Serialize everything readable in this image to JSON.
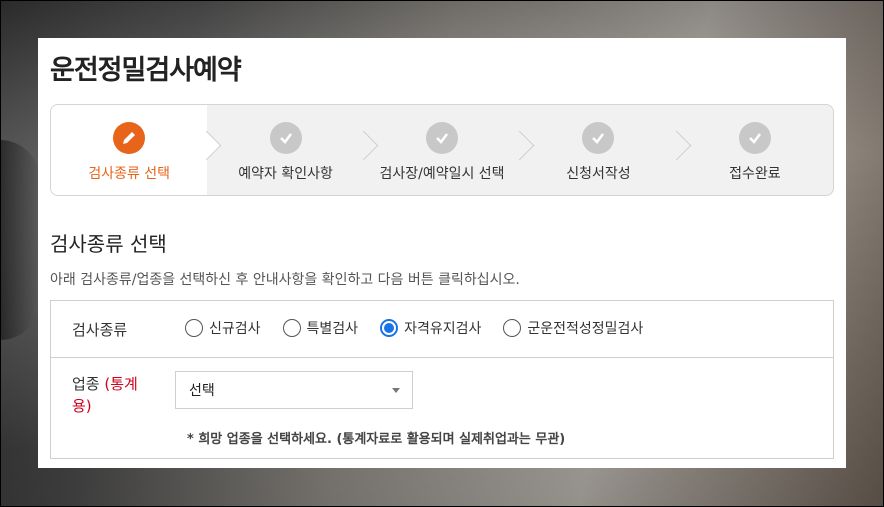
{
  "page": {
    "title": "운전정밀검사예약"
  },
  "steps": [
    {
      "label": "검사종류 선택",
      "icon": "pencil-icon",
      "active": true
    },
    {
      "label": "예약자 확인사항",
      "icon": "check-icon",
      "active": false
    },
    {
      "label": "검사장/예약일시 선택",
      "icon": "check-icon",
      "active": false
    },
    {
      "label": "신청서작성",
      "icon": "check-icon",
      "active": false
    },
    {
      "label": "접수완료",
      "icon": "check-icon",
      "active": false
    }
  ],
  "section": {
    "title": "검사종류 선택",
    "description": "아래 검사종류/업종을 선택하신 후 안내사항을 확인하고 다음 버튼 클릭하십시오."
  },
  "form": {
    "inspection_type_label": "검사종류",
    "inspection_types": [
      "신규검사",
      "특별검사",
      "자격유지검사",
      "군운전적성정밀검사"
    ],
    "selected_type": "자격유지검사",
    "business_label": "업종",
    "business_label_note": "(통계용)",
    "business_select_value": "선택",
    "business_hint": "* 희망 업종을 선택하세요. (통계자료로 활용되며 실제취업과는 무관)"
  },
  "colors": {
    "accent": "#e8641a",
    "radio_selected": "#1a73e8",
    "required_red": "#d0021b"
  }
}
